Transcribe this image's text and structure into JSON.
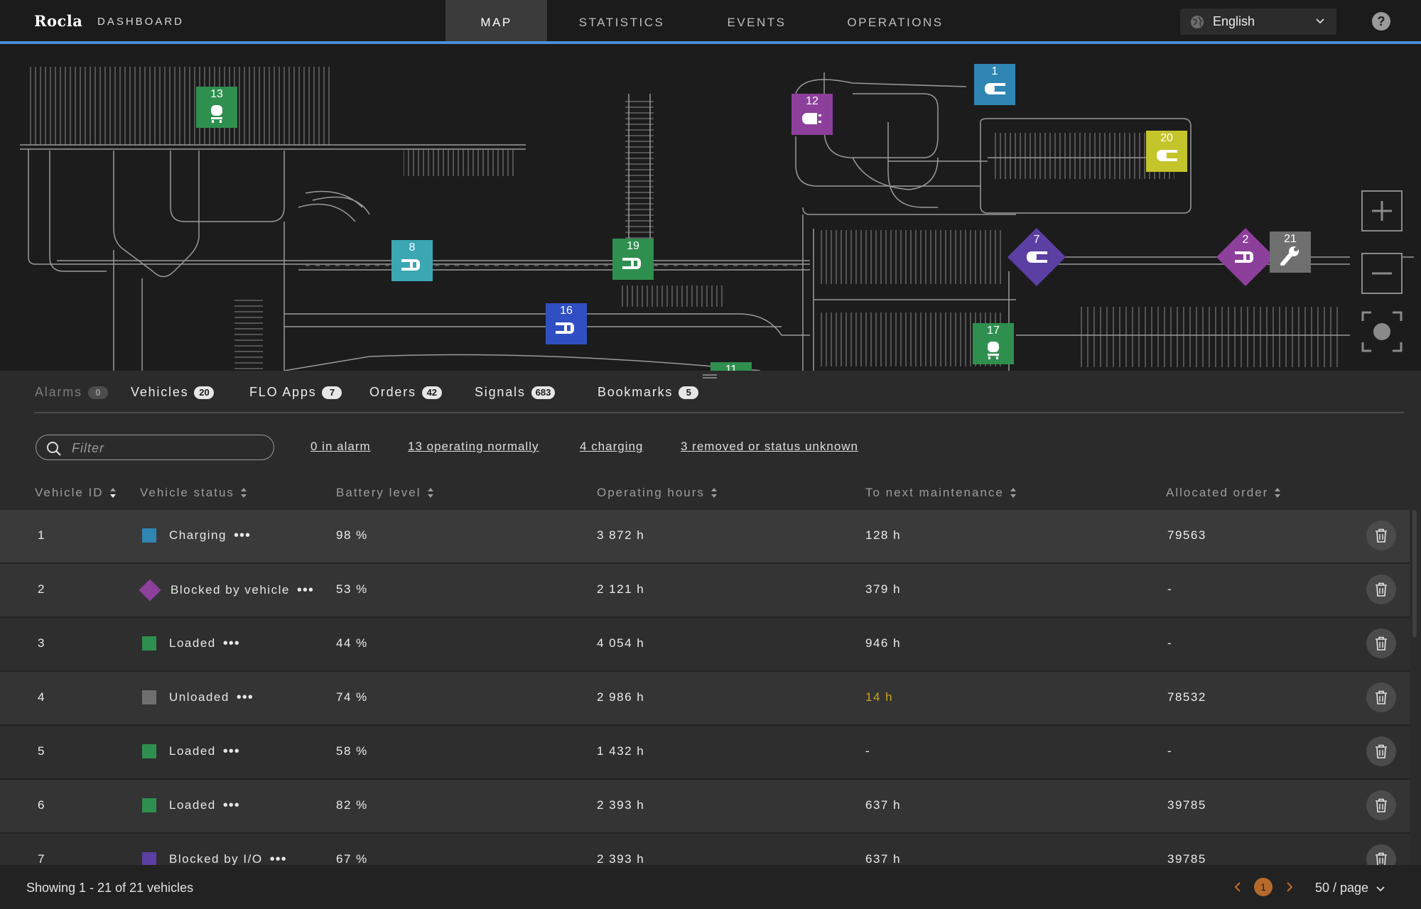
{
  "app": {
    "logo": "Rocla",
    "title": "DASHBOARD"
  },
  "nav": {
    "tabs": [
      {
        "label": "MAP",
        "active": true
      },
      {
        "label": "STATISTICS"
      },
      {
        "label": "EVENTS"
      },
      {
        "label": "OPERATIONS"
      }
    ]
  },
  "language": {
    "selected": "English",
    "icon": "globe-icon"
  },
  "help": {
    "label": "?"
  },
  "colors": {
    "charging": "#2f86b3",
    "blocked_by_vehicle": "#8d3f9c",
    "loaded": "#2f8f4f",
    "unloaded": "#6f6f6f",
    "blocked_by_io": "#5b3fa3",
    "teal": "#3aa7b3",
    "blue": "#2f4fc2",
    "yellow": "#c4c42b",
    "warning": "#c9a227",
    "accent": "#4a8fd6"
  },
  "map": {
    "vehicles": [
      {
        "id": "13",
        "color": "#2f8f4f",
        "shape": "square",
        "icon": "forklift-front-icon"
      },
      {
        "id": "1",
        "color": "#2f86b3",
        "shape": "square",
        "icon": "vehicle-left-icon"
      },
      {
        "id": "12",
        "color": "#8d3f9c",
        "shape": "square",
        "icon": "vehicle-left-icon"
      },
      {
        "id": "20",
        "color": "#c4c42b",
        "shape": "square",
        "icon": "vehicle-left-icon"
      },
      {
        "id": "8",
        "color": "#3aa7b3",
        "shape": "square",
        "icon": "vehicle-right-icon"
      },
      {
        "id": "19",
        "color": "#2f8f4f",
        "shape": "square",
        "icon": "vehicle-right-icon"
      },
      {
        "id": "16",
        "color": "#2f4fc2",
        "shape": "square",
        "icon": "vehicle-right-icon"
      },
      {
        "id": "7",
        "color": "#5b3fa3",
        "shape": "diamond",
        "icon": "vehicle-left-icon"
      },
      {
        "id": "2",
        "color": "#8d3f9c",
        "shape": "diamond",
        "icon": "vehicle-right-icon"
      },
      {
        "id": "21",
        "color": "#6f6f6f",
        "shape": "square",
        "icon": "wrench-icon"
      },
      {
        "id": "17",
        "color": "#2f8f4f",
        "shape": "square",
        "icon": "forklift-front-icon"
      },
      {
        "id": "11",
        "color": "#2f8f4f",
        "shape": "square",
        "icon": ""
      }
    ],
    "controls": {
      "zoom_in": "plus-icon",
      "zoom_out": "minus-icon",
      "locate": "locate-icon"
    }
  },
  "panel_tabs": [
    {
      "label": "Alarms",
      "count": "0",
      "dim": true
    },
    {
      "label": "Vehicles",
      "count": "20"
    },
    {
      "label": "FLO Apps",
      "count": "7"
    },
    {
      "label": "Orders",
      "count": "42"
    },
    {
      "label": "Signals",
      "count": "683"
    },
    {
      "label": "Bookmarks",
      "count": "5"
    }
  ],
  "filter": {
    "placeholder": "Filter",
    "value": ""
  },
  "quick_filters": [
    "0 in alarm",
    "13 operating normally",
    "4 charging",
    "3 removed or status unknown"
  ],
  "table": {
    "headers": [
      "Vehicle ID",
      "Vehicle status",
      "Battery level",
      "Operating hours",
      "To next maintenance",
      "Allocated order"
    ],
    "rows": [
      {
        "id": "1",
        "status": "Charging",
        "status_color": "#2f86b3",
        "shape": "square",
        "battery": "98 %",
        "hours": "3 872 h",
        "maint": "128 h",
        "order": "79563"
      },
      {
        "id": "2",
        "status": "Blocked by vehicle",
        "status_color": "#8d3f9c",
        "shape": "diamond",
        "battery": "53 %",
        "hours": "2 121 h",
        "maint": "379 h",
        "order": "-"
      },
      {
        "id": "3",
        "status": "Loaded",
        "status_color": "#2f8f4f",
        "shape": "square",
        "battery": "44 %",
        "hours": "4 054 h",
        "maint": "946 h",
        "order": "-"
      },
      {
        "id": "4",
        "status": "Unloaded",
        "status_color": "#6f6f6f",
        "shape": "square",
        "battery": "74 %",
        "hours": "2 986 h",
        "maint": "14 h",
        "maint_warning": true,
        "order": "78532"
      },
      {
        "id": "5",
        "status": "Loaded",
        "status_color": "#2f8f4f",
        "shape": "square",
        "battery": "58 %",
        "hours": "1 432 h",
        "maint": "-",
        "order": "-"
      },
      {
        "id": "6",
        "status": "Loaded",
        "status_color": "#2f8f4f",
        "shape": "square",
        "battery": "82 %",
        "hours": "2 393 h",
        "maint": "637 h",
        "order": "39785"
      },
      {
        "id": "7",
        "status": "Blocked by I/O",
        "status_color": "#5b3fa3",
        "shape": "square",
        "battery": "67 %",
        "hours": "2 393 h",
        "maint": "637 h",
        "order": "39785"
      }
    ],
    "more_icon": "more-dots-icon",
    "delete_icon": "trash-icon"
  },
  "footer": {
    "showing": "Showing 1 - 21 of 21 vehicles",
    "page": "1",
    "per_page": "50 / page"
  }
}
